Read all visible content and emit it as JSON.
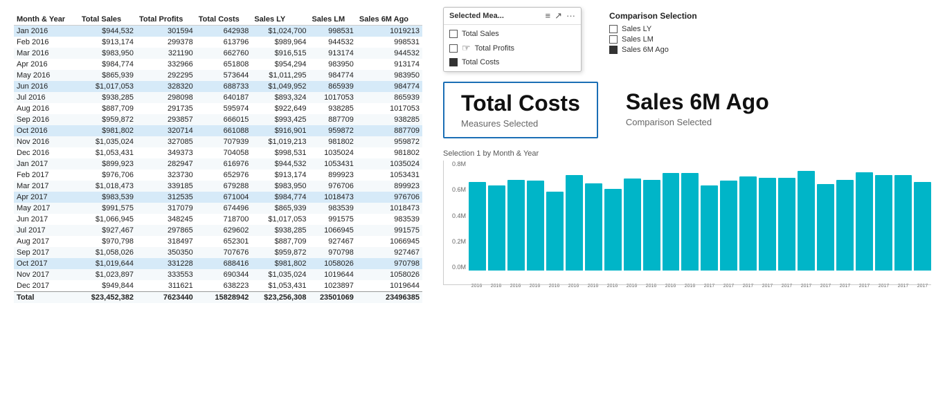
{
  "table": {
    "columns": [
      "Month & Year",
      "Total Sales",
      "Total Profits",
      "Total Costs",
      "Sales LY",
      "Sales LM",
      "Sales 6M Ago"
    ],
    "rows": [
      [
        "Jan 2016",
        "$944,532",
        "301594",
        "642938",
        "$1,024,700",
        "998531",
        "1019213"
      ],
      [
        "Feb 2016",
        "$913,174",
        "299378",
        "613796",
        "$989,964",
        "944532",
        "998531"
      ],
      [
        "Mar 2016",
        "$983,950",
        "321190",
        "662760",
        "$916,515",
        "913174",
        "944532"
      ],
      [
        "Apr 2016",
        "$984,774",
        "332966",
        "651808",
        "$954,294",
        "983950",
        "913174"
      ],
      [
        "May 2016",
        "$865,939",
        "292295",
        "573644",
        "$1,011,295",
        "984774",
        "983950"
      ],
      [
        "Jun 2016",
        "$1,017,053",
        "328320",
        "688733",
        "$1,049,952",
        "865939",
        "984774"
      ],
      [
        "Jul 2016",
        "$938,285",
        "298098",
        "640187",
        "$893,324",
        "1017053",
        "865939"
      ],
      [
        "Aug 2016",
        "$887,709",
        "291735",
        "595974",
        "$922,649",
        "938285",
        "1017053"
      ],
      [
        "Sep 2016",
        "$959,872",
        "293857",
        "666015",
        "$993,425",
        "887709",
        "938285"
      ],
      [
        "Oct 2016",
        "$981,802",
        "320714",
        "661088",
        "$916,901",
        "959872",
        "887709"
      ],
      [
        "Nov 2016",
        "$1,035,024",
        "327085",
        "707939",
        "$1,019,213",
        "981802",
        "959872"
      ],
      [
        "Dec 2016",
        "$1,053,431",
        "349373",
        "704058",
        "$998,531",
        "1035024",
        "981802"
      ],
      [
        "Jan 2017",
        "$899,923",
        "282947",
        "616976",
        "$944,532",
        "1053431",
        "1035024"
      ],
      [
        "Feb 2017",
        "$976,706",
        "323730",
        "652976",
        "$913,174",
        "899923",
        "1053431"
      ],
      [
        "Mar 2017",
        "$1,018,473",
        "339185",
        "679288",
        "$983,950",
        "976706",
        "899923"
      ],
      [
        "Apr 2017",
        "$983,539",
        "312535",
        "671004",
        "$984,774",
        "1018473",
        "976706"
      ],
      [
        "May 2017",
        "$991,575",
        "317079",
        "674496",
        "$865,939",
        "983539",
        "1018473"
      ],
      [
        "Jun 2017",
        "$1,066,945",
        "348245",
        "718700",
        "$1,017,053",
        "991575",
        "983539"
      ],
      [
        "Jul 2017",
        "$927,467",
        "297865",
        "629602",
        "$938,285",
        "1066945",
        "991575"
      ],
      [
        "Aug 2017",
        "$970,798",
        "318497",
        "652301",
        "$887,709",
        "927467",
        "1066945"
      ],
      [
        "Sep 2017",
        "$1,058,026",
        "350350",
        "707676",
        "$959,872",
        "970798",
        "927467"
      ],
      [
        "Oct 2017",
        "$1,019,644",
        "331228",
        "688416",
        "$981,802",
        "1058026",
        "970798"
      ],
      [
        "Nov 2017",
        "$1,023,897",
        "333553",
        "690344",
        "$1,035,024",
        "1019644",
        "1058026"
      ],
      [
        "Dec 2017",
        "$949,844",
        "311621",
        "638223",
        "$1,053,431",
        "1023897",
        "1019644"
      ]
    ],
    "total": [
      "Total",
      "$23,452,382",
      "7623440",
      "15828942",
      "$23,256,308",
      "23501069",
      "23496385"
    ],
    "highlight_rows": [
      0,
      5,
      9,
      15,
      21
    ]
  },
  "selector": {
    "title": "Selected Mea...",
    "items": [
      {
        "label": "Total Sales",
        "checked": false
      },
      {
        "label": "Total Profits",
        "checked": false
      },
      {
        "label": "Total Costs",
        "checked": true
      }
    ]
  },
  "comparison": {
    "title": "Comparison Selection",
    "items": [
      {
        "label": "Sales LY",
        "checked": false
      },
      {
        "label": "Sales LM",
        "checked": false
      },
      {
        "label": "Sales 6M Ago",
        "checked": true
      }
    ]
  },
  "measure_selected": {
    "name": "Total Costs",
    "sub": "Measures Selected"
  },
  "comparison_selected": {
    "name": "Sales 6M Ago",
    "sub": "Comparison Selected"
  },
  "chart": {
    "title": "Selection 1 by Month & Year",
    "y_labels": [
      "0.8M",
      "0.6M",
      "0.4M",
      "0.2M",
      "0.0M"
    ],
    "bars": [
      {
        "label": "2016",
        "height_pct": 80
      },
      {
        "label": "2016",
        "height_pct": 77
      },
      {
        "label": "2016",
        "height_pct": 82
      },
      {
        "label": "2016",
        "height_pct": 81
      },
      {
        "label": "2016",
        "height_pct": 71
      },
      {
        "label": "2016",
        "height_pct": 86
      },
      {
        "label": "2016",
        "height_pct": 79
      },
      {
        "label": "2016",
        "height_pct": 74
      },
      {
        "label": "2016",
        "height_pct": 83
      },
      {
        "label": "2016",
        "height_pct": 82
      },
      {
        "label": "2016",
        "height_pct": 88
      },
      {
        "label": "2016",
        "height_pct": 88
      },
      {
        "label": "2017",
        "height_pct": 77
      },
      {
        "label": "2017",
        "height_pct": 81
      },
      {
        "label": "2017",
        "height_pct": 85
      },
      {
        "label": "2017",
        "height_pct": 84
      },
      {
        "label": "2017",
        "height_pct": 84
      },
      {
        "label": "2017",
        "height_pct": 90
      },
      {
        "label": "2017",
        "height_pct": 78
      },
      {
        "label": "2017",
        "height_pct": 82
      },
      {
        "label": "2017",
        "height_pct": 89
      },
      {
        "label": "2017",
        "height_pct": 86
      },
      {
        "label": "2017",
        "height_pct": 86
      },
      {
        "label": "2017",
        "height_pct": 80
      }
    ]
  }
}
